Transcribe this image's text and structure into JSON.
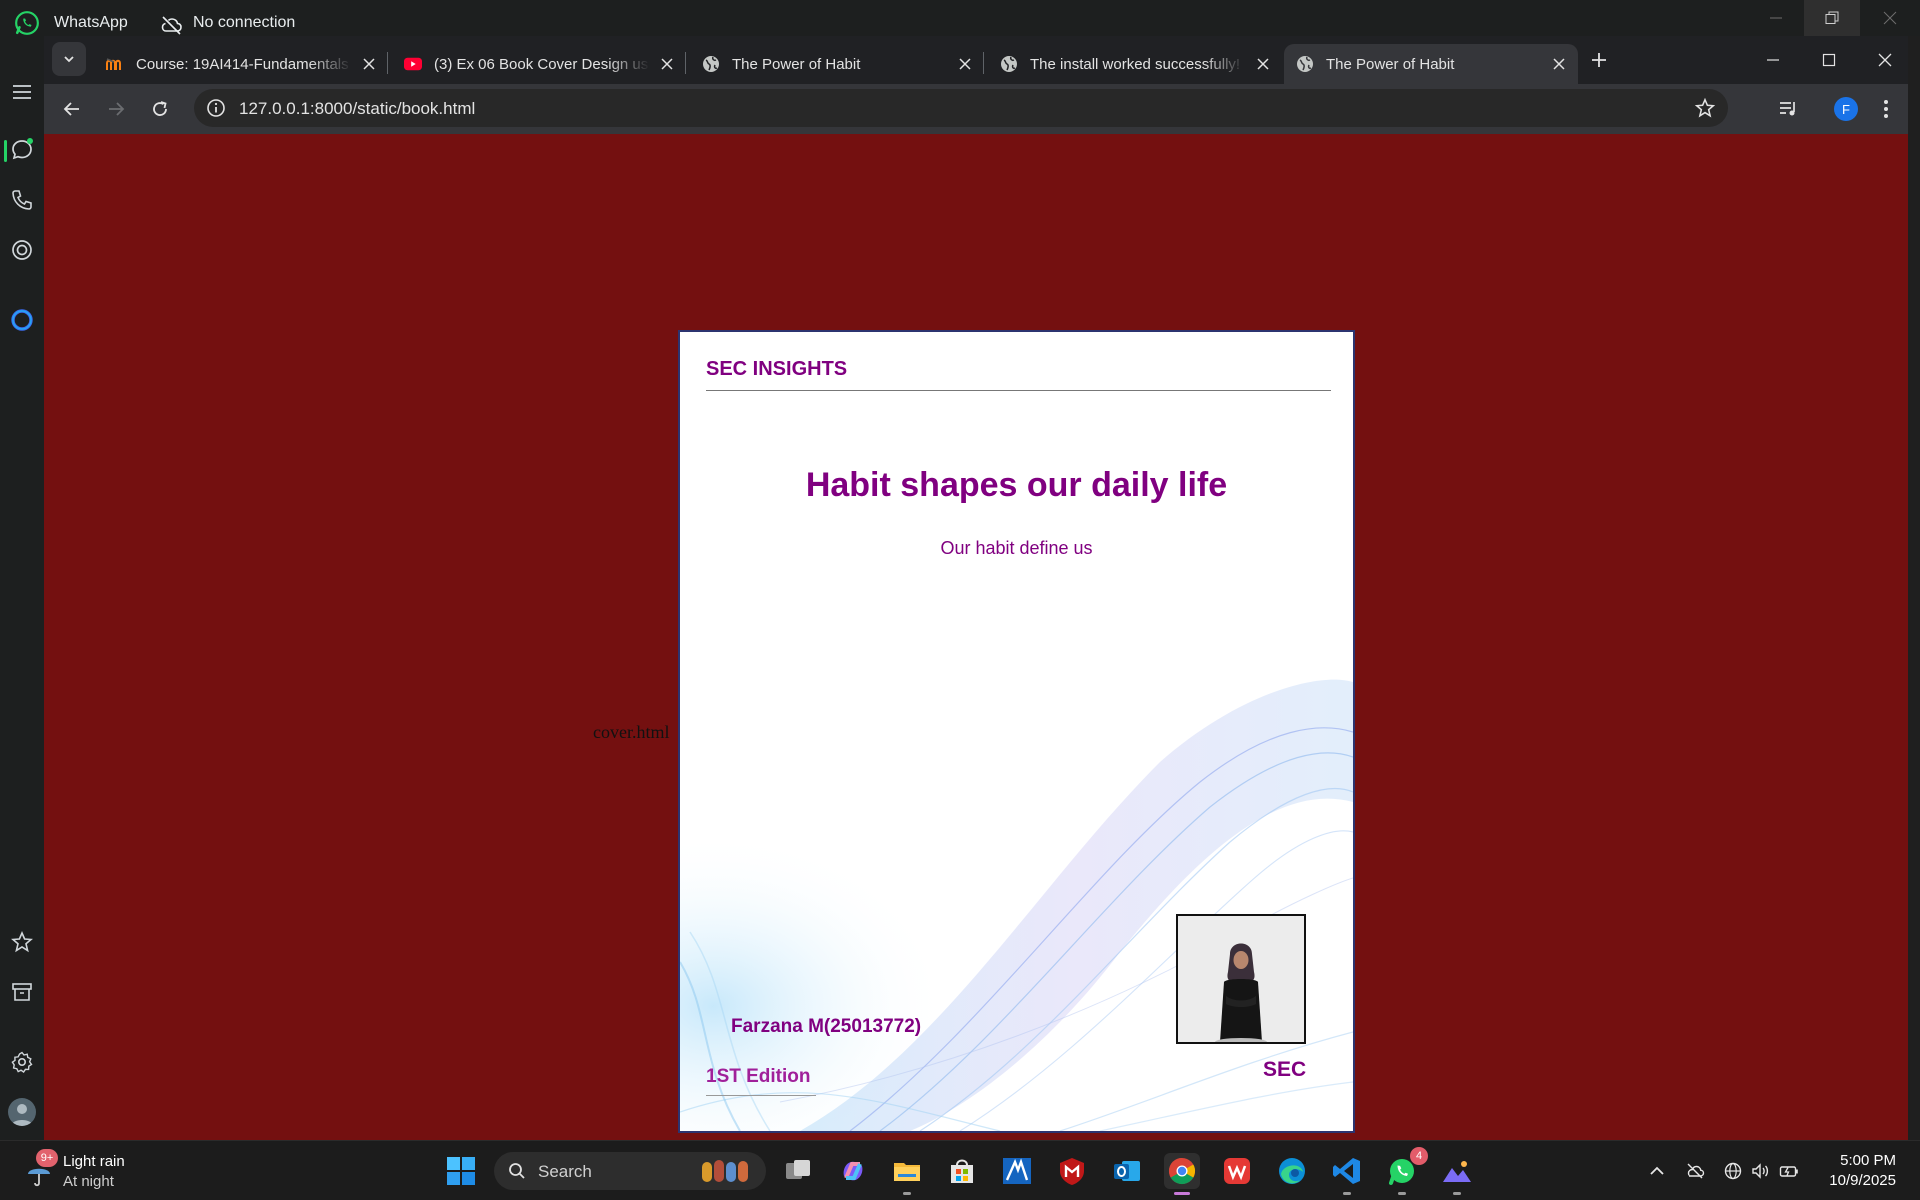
{
  "whatsapp": {
    "app_name": "WhatsApp",
    "connection_status": "No connection",
    "accent_color": "#25d366"
  },
  "chrome": {
    "tabs": [
      {
        "title": "Course: 19AI414-Fundamentals",
        "favicon": "moodle-icon",
        "active": false
      },
      {
        "title": "(3) Ex 06 Book Cover Design usi",
        "favicon": "youtube-icon",
        "active": false
      },
      {
        "title": "The Power of Habit",
        "favicon": "globe-icon",
        "active": false
      },
      {
        "title": "The install worked successfully!",
        "favicon": "globe-icon",
        "active": false
      },
      {
        "title": "The Power of Habit",
        "favicon": "globe-icon",
        "active": true
      }
    ],
    "url": "127.0.0.1:8000/static/book.html",
    "profile_initial": "F"
  },
  "page": {
    "background_color": "#741010",
    "stray_text": "cover.html",
    "cover": {
      "brand": "SEC INSIGHTS",
      "title": "Habit shapes our daily life",
      "subtitle": "Our habit define us",
      "author": "Farzana M(25013772)",
      "publisher": "SEC",
      "edition": "1ST Edition",
      "text_color": "#800080"
    }
  },
  "taskbar": {
    "weather": {
      "badge": "9+",
      "condition": "Light rain",
      "period": "At night"
    },
    "search_placeholder": "Search",
    "whatsapp_badge": "4",
    "time": "5:00 PM",
    "date": "10/9/2025"
  }
}
